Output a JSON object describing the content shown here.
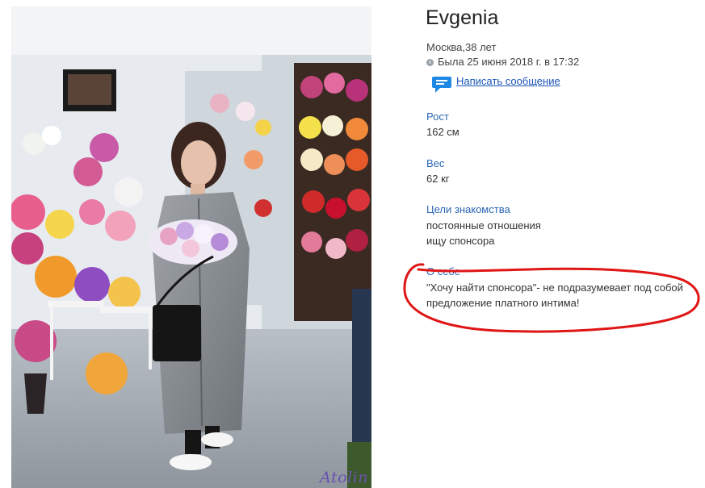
{
  "profile": {
    "name": "Evgenia",
    "location": "Москва,38 лет",
    "last_seen": "Была 25 июня 2018 г. в 17:32",
    "message_link": "Написать сообщение"
  },
  "details": {
    "height": {
      "label": "Рост",
      "value": "162 см"
    },
    "weight": {
      "label": "Вес",
      "value": "62 кг"
    },
    "goals": {
      "label": "Цели знакомства",
      "values": [
        "постоянные отношения",
        "ищу спонсора"
      ]
    },
    "about": {
      "label": "О себе",
      "lines": [
        "\"Хочу найти спонсора\"- не подразумевает под собой",
        "предложение платного интима!"
      ]
    }
  },
  "photo": {
    "watermark": "Atolin"
  },
  "colors": {
    "link": "#1a55b8",
    "label": "#2a67b5",
    "annotation": "#e01515",
    "chat_icon": "#1e88e5"
  },
  "icons": {
    "last_seen": "clock-icon",
    "message": "chat-bubble-icon"
  }
}
